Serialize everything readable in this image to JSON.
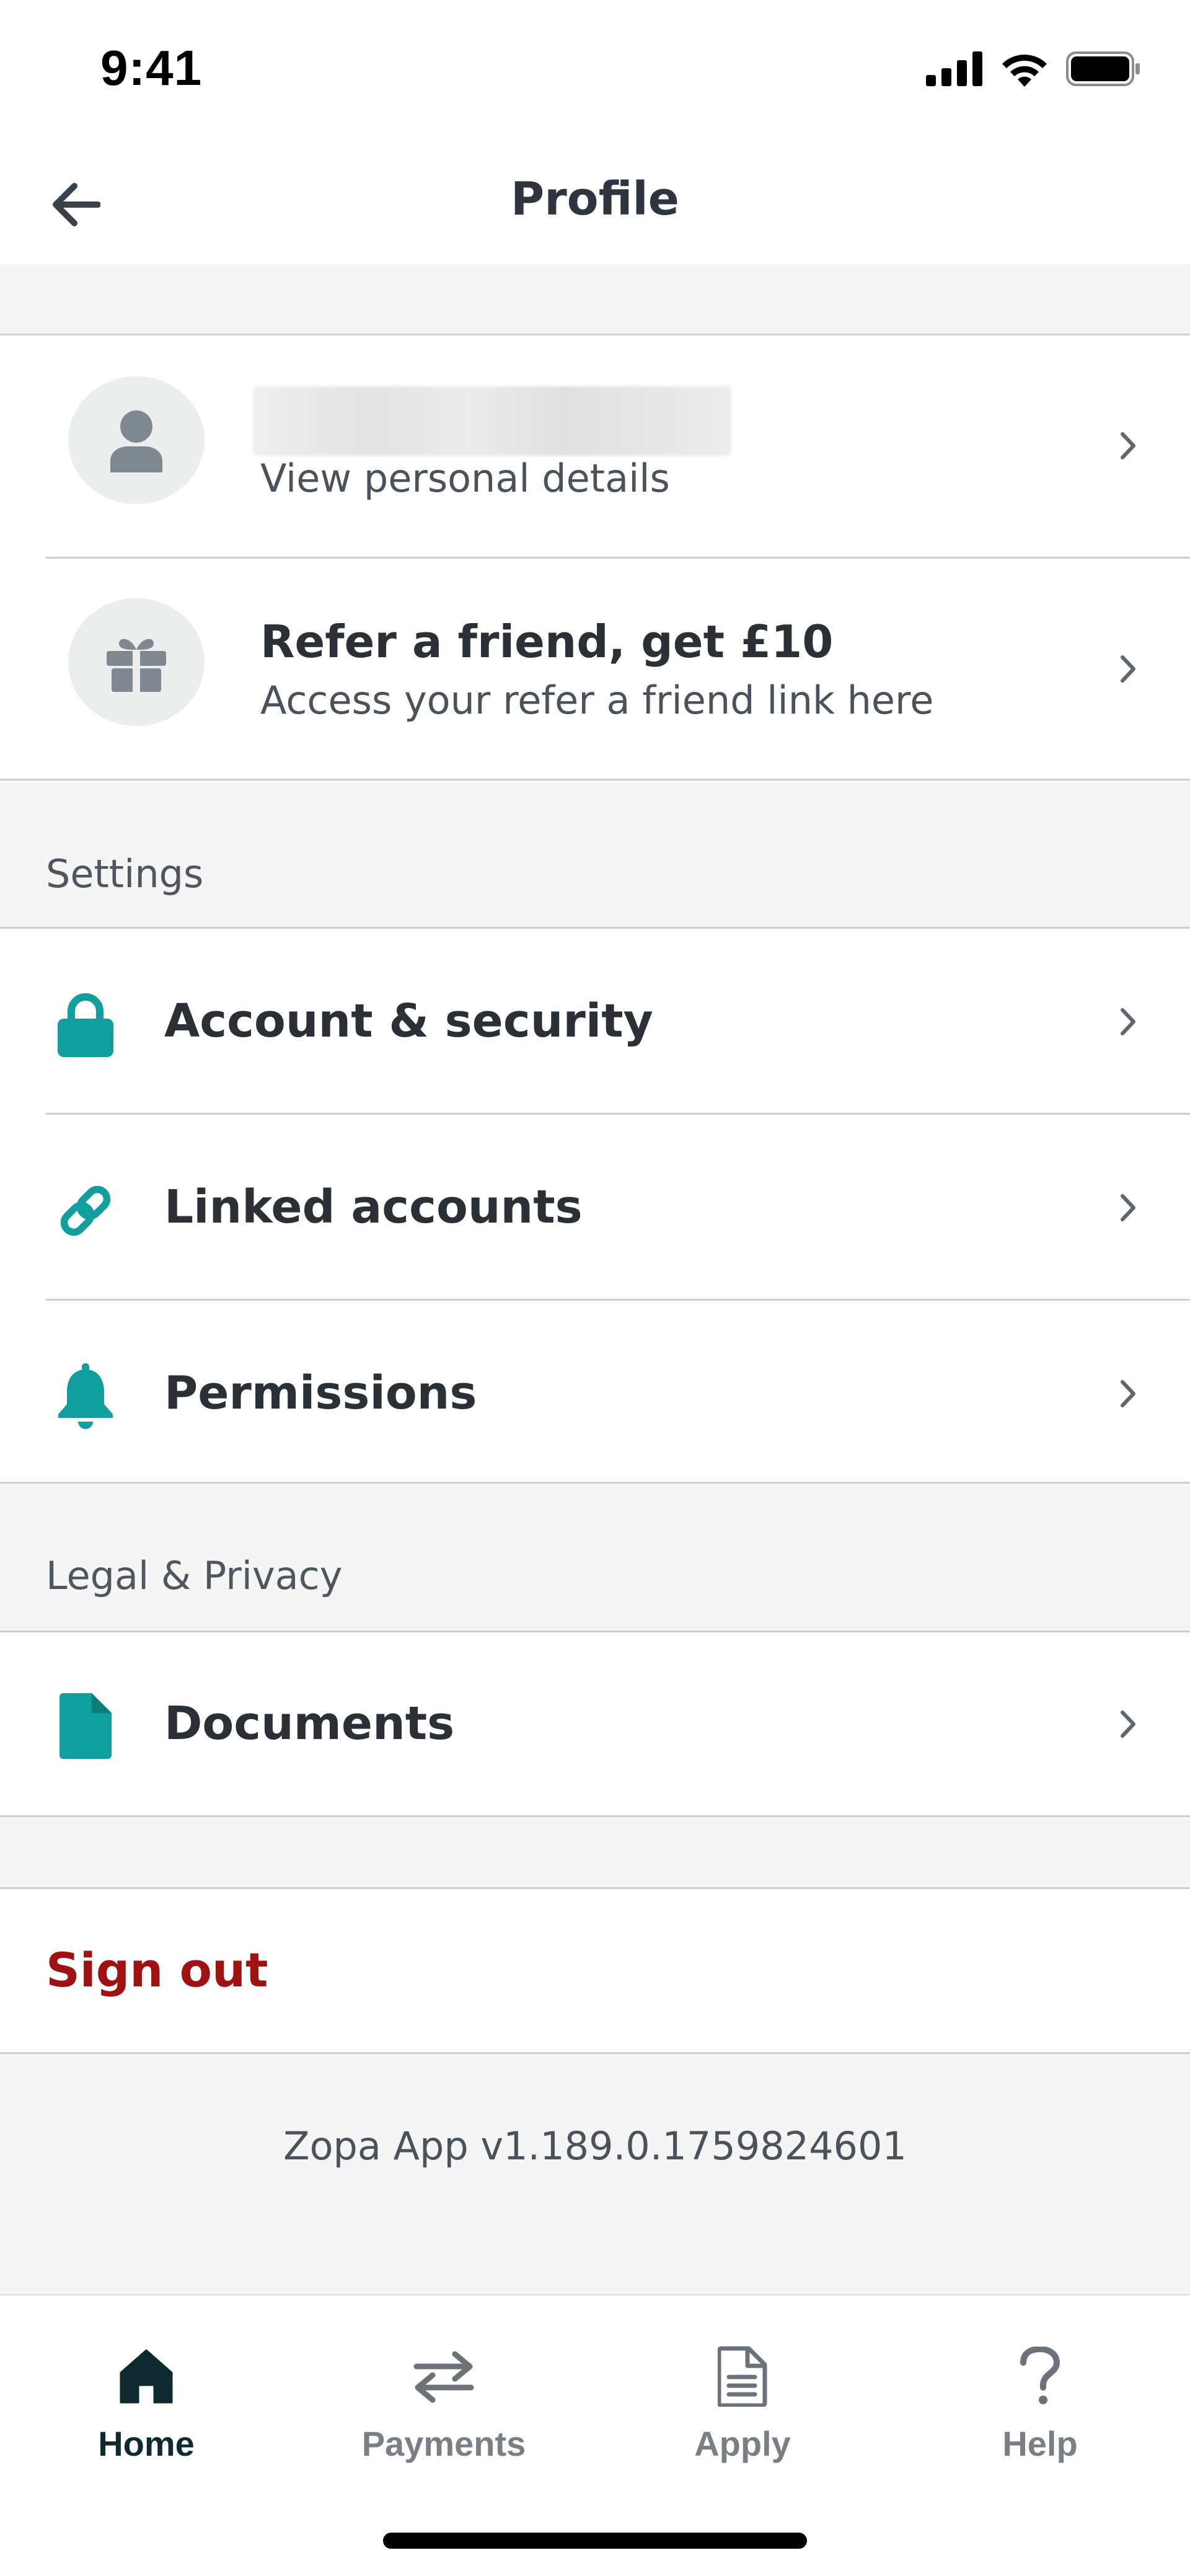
{
  "status_bar": {
    "time": "9:41"
  },
  "header": {
    "title": "Profile"
  },
  "profile": {
    "subtitle": "View personal details"
  },
  "referral": {
    "title": "Refer a friend, get £10",
    "subtitle": "Access your refer a friend link here"
  },
  "settings": {
    "label": "Settings",
    "items": [
      {
        "label": "Account & security",
        "icon": "lock-icon"
      },
      {
        "label": "Linked accounts",
        "icon": "link-icon"
      },
      {
        "label": "Permissions",
        "icon": "bell-icon"
      }
    ]
  },
  "legal": {
    "label": "Legal & Privacy",
    "items": [
      {
        "label": "Documents",
        "icon": "document-icon"
      }
    ]
  },
  "sign_out": {
    "label": "Sign out"
  },
  "footer": {
    "version": "Zopa App v1.189.0.1759824601"
  },
  "bottom_nav": {
    "items": [
      {
        "label": "Home",
        "icon": "home-icon",
        "active": true
      },
      {
        "label": "Payments",
        "icon": "transfer-icon",
        "active": false
      },
      {
        "label": "Apply",
        "icon": "document-icon",
        "active": false
      },
      {
        "label": "Help",
        "icon": "question-icon",
        "active": false
      }
    ]
  },
  "colors": {
    "accent": "#119e9e",
    "danger": "#a01212",
    "background": "#f5f5f5",
    "active_nav": "#0f2a2e"
  }
}
